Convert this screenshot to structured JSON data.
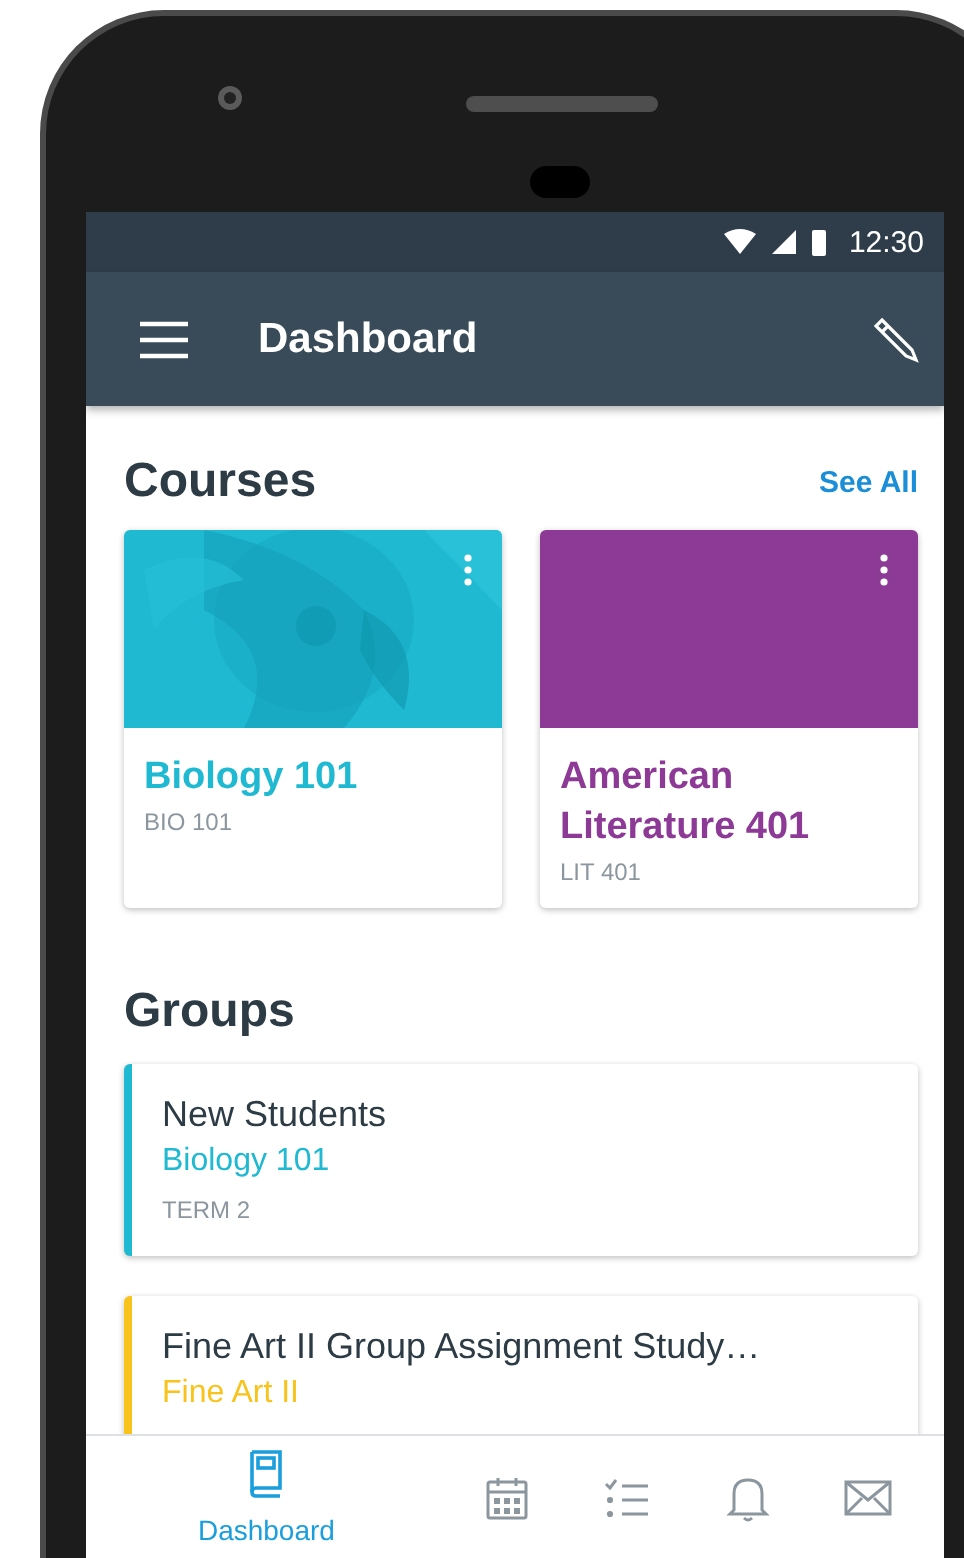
{
  "status_bar": {
    "time": "12:30"
  },
  "app_bar": {
    "title": "Dashboard"
  },
  "courses": {
    "heading": "Courses",
    "see_all": "See All",
    "items": [
      {
        "name": "Biology 101",
        "code": "BIO 101",
        "color": "#1fb9d2"
      },
      {
        "name": "American Literature 401",
        "code": "LIT 401",
        "color": "#8c3a96"
      }
    ]
  },
  "groups": {
    "heading": "Groups",
    "items": [
      {
        "name": "New Students",
        "course": "Biology 101",
        "term": "TERM 2",
        "color": "#1fb9d2"
      },
      {
        "name": "Fine Art II Group Assignment Study…",
        "course": "Fine Art II",
        "color": "#f7c31c"
      }
    ]
  },
  "tab_bar": [
    {
      "kind": "dashboard",
      "label": "Dashboard",
      "selected": true
    },
    {
      "kind": "calendar",
      "selected": false
    },
    {
      "kind": "todo",
      "selected": false
    },
    {
      "kind": "notifications",
      "selected": false
    },
    {
      "kind": "inbox",
      "selected": false
    }
  ]
}
